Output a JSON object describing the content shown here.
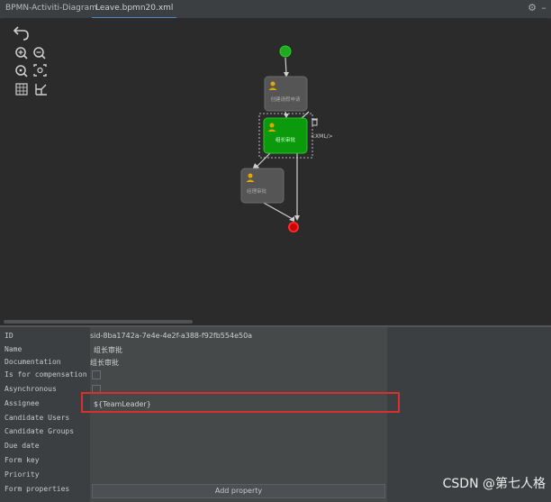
{
  "tabs": [
    {
      "label": "BPMN-Activiti-Diagram"
    },
    {
      "label": "Leave.bpmn20.xml"
    }
  ],
  "toolbar": {
    "icons": [
      "undo-icon",
      "zoom-in-icon",
      "zoom-out-icon",
      "zoom-reset-icon",
      "fit-icon",
      "grid-icon",
      "layout-icon"
    ]
  },
  "diagram": {
    "task1_label": "创建请假申请",
    "task2_label": "组长审批",
    "task3_label": "经理审批",
    "xml_label": "<XML/>"
  },
  "properties": {
    "rows": [
      {
        "label": "ID",
        "value": "sid-8ba1742a-7e4e-4e2f-a388-f92fb554e50a"
      },
      {
        "label": "Name",
        "value": "组长审批"
      },
      {
        "label": "Documentation",
        "value": "组长审批"
      },
      {
        "label": "Is for compensation",
        "value": ""
      },
      {
        "label": "Asynchronous",
        "value": ""
      },
      {
        "label": "Assignee",
        "value": "${TeamLeader}"
      },
      {
        "label": "Candidate Users",
        "value": ""
      },
      {
        "label": "Candidate Groups",
        "value": ""
      },
      {
        "label": "Due date",
        "value": ""
      },
      {
        "label": "Form key",
        "value": ""
      },
      {
        "label": "Priority",
        "value": ""
      },
      {
        "label": "Form properties",
        "value": ""
      }
    ],
    "add_property_label": "Add property"
  },
  "watermark": "CSDN @第七人格",
  "colors": {
    "selected_task": "#0b9a0b",
    "task": "#555555",
    "start": "#1faa1f",
    "end": "#e01818",
    "highlight": "#d9302c"
  }
}
